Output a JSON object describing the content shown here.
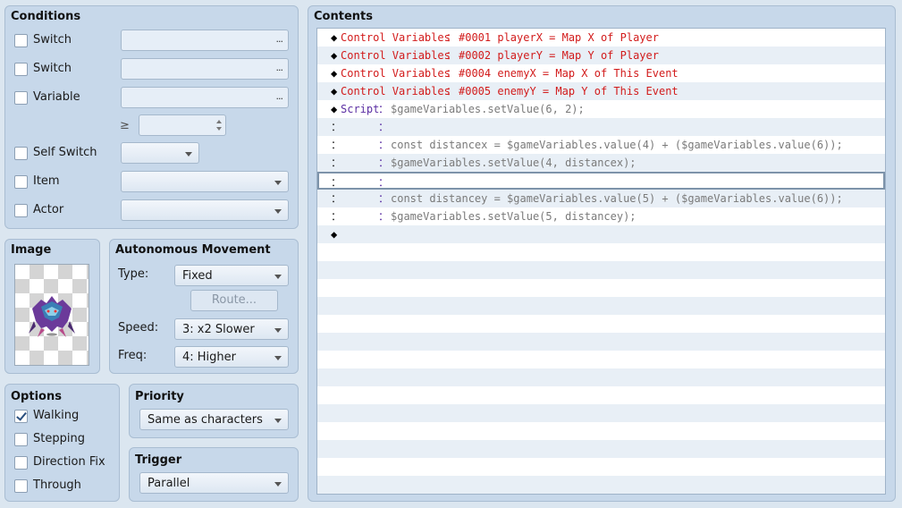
{
  "conditions": {
    "title": "Conditions",
    "switch1_label": "Switch",
    "switch2_label": "Switch",
    "variable_label": "Variable",
    "ellipsis": "...",
    "gte_symbol": "≥",
    "self_switch_label": "Self Switch",
    "item_label": "Item",
    "actor_label": "Actor"
  },
  "image": {
    "title": "Image"
  },
  "autonomous": {
    "title": "Autonomous Movement",
    "type_label": "Type:",
    "type_value": "Fixed",
    "route_button": "Route...",
    "speed_label": "Speed:",
    "speed_value": "3: x2 Slower",
    "freq_label": "Freq:",
    "freq_value": "4: Higher"
  },
  "options": {
    "title": "Options",
    "walking": "Walking",
    "stepping": "Stepping",
    "direction_fix": "Direction Fix",
    "through": "Through",
    "walking_checked": true
  },
  "priority": {
    "title": "Priority",
    "value": "Same as characters"
  },
  "trigger": {
    "title": "Trigger",
    "value": "Parallel"
  },
  "contents": {
    "title": "Contents",
    "rows": [
      {
        "marker": "◆",
        "cmd": "Control Variables",
        "sep": "：",
        "text": "#0001 playerX = Map X of Player"
      },
      {
        "marker": "◆",
        "cmd": "Control Variables",
        "sep": "：",
        "text": "#0002 playerY = Map Y of Player"
      },
      {
        "marker": "◆",
        "cmd": "Control Variables",
        "sep": "：",
        "text": "#0004 enemyX = Map X of This Event"
      },
      {
        "marker": "◆",
        "cmd": "Control Variables",
        "sep": "：",
        "text": "#0005 enemyY = Map Y of This Event"
      },
      {
        "marker": "◆",
        "cmd": "Script",
        "sep": "：",
        "text": "$gameVariables.setValue(6, 2);"
      },
      {
        "marker": "：",
        "cmd": "",
        "sep": "：",
        "text": ""
      },
      {
        "marker": "：",
        "cmd": "",
        "sep": "：",
        "text": "const distancex = $gameVariables.value(4) + ($gameVariables.value(6));"
      },
      {
        "marker": "：",
        "cmd": "",
        "sep": "：",
        "text": "$gameVariables.setValue(4, distancex);"
      },
      {
        "marker": "：",
        "cmd": "",
        "sep": "：",
        "text": ""
      },
      {
        "marker": "：",
        "cmd": "",
        "sep": "：",
        "text": "const distancey = $gameVariables.value(5) + ($gameVariables.value(6));"
      },
      {
        "marker": "：",
        "cmd": "",
        "sep": "：",
        "text": "$gameVariables.setValue(5, distancey);"
      },
      {
        "marker": "◆",
        "cmd": "",
        "sep": "",
        "text": ""
      }
    ]
  }
}
